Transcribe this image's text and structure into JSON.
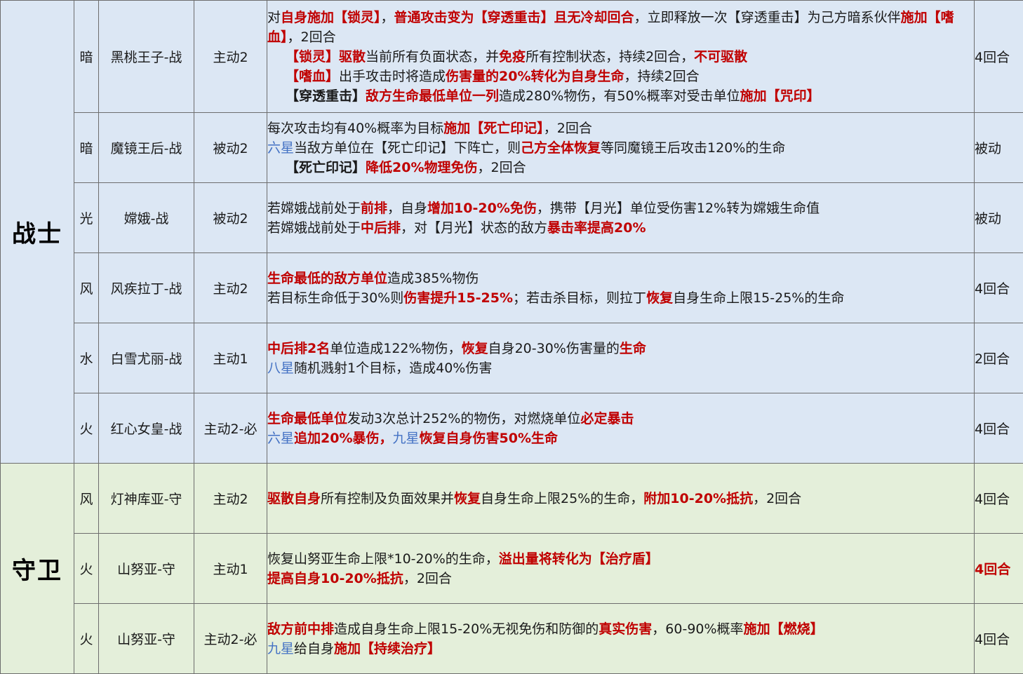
{
  "categories": {
    "warrior": "战士",
    "guard": "守卫"
  },
  "rows": [
    {
      "element": "暗",
      "name": "黑桃王子-战",
      "type": "主动2",
      "cd": "4回合",
      "lines": [
        [
          "对",
          "自身施加【锁灵】",
          "，",
          "普通攻击变为【穿透重击】且无冷却回合",
          "，立即释放一次【穿透重击】为己方暗系伙伴",
          "施加【嗜血】",
          "，2回合"
        ],
        [
          "【锁灵】",
          "驱散",
          "当前所有负面状态，并",
          "免疫",
          "所有控制状态，持续2回合，",
          "不可驱散"
        ],
        [
          "【嗜血】",
          "出手攻击时将造成",
          "伤害量的20%转化为自身生命",
          "，持续2回合"
        ],
        [
          "【穿透重击】",
          "敌方生命最低单位一列",
          "造成280%物伤，有50%概率对受击单位",
          "施加【咒印】"
        ]
      ]
    },
    {
      "element": "暗",
      "name": "魔镜王后-战",
      "type": "被动2",
      "cd": "被动",
      "lines": [
        [
          "每次攻击均有40%概率为目标",
          "施加【死亡印记】",
          "，2回合"
        ],
        [
          "六星",
          "当敌方单位在【死亡印记】下阵亡，则",
          "己方全体恢复",
          "等同魔镜王后攻击120%的生命"
        ],
        [
          "【死亡印记】",
          "降低20%物理免伤",
          "，2回合"
        ]
      ]
    },
    {
      "element": "光",
      "name": "嫦娥-战",
      "type": "被动2",
      "cd": "被动",
      "lines": [
        [
          "若嫦娥战前处于",
          "前排",
          "，自身",
          "增加10-20%免伤",
          "，携带【月光】单位受伤害12%转为嫦娥生命值"
        ],
        [
          "若嫦娥战前处于",
          "中后排",
          "，对【月光】状态的敌方",
          "暴击率提高20%"
        ]
      ]
    },
    {
      "element": "风",
      "name": "风疾拉丁-战",
      "type": "主动2",
      "cd": "4回合",
      "lines": [
        [
          "生命最低的敌方单位",
          "造成385%物伤"
        ],
        [
          "若目标生命低于30%则",
          "伤害提升15-25%",
          "；若击杀目标，则拉丁",
          "恢复",
          "自身生命上限15-25%的生命"
        ]
      ]
    },
    {
      "element": "水",
      "name": "白雪尤丽-战",
      "type": "主动1",
      "cd": "2回合",
      "lines": [
        [
          "中后排2名",
          "单位造成122%物伤，",
          "恢复",
          "自身20-30%伤害量的",
          "生命"
        ],
        [
          "八星",
          "随机溅射1个目标，造成40%伤害"
        ]
      ]
    },
    {
      "element": "火",
      "name": "红心女皇-战",
      "type": "主动2-必",
      "cd": "4回合",
      "lines": [
        [
          "生命最低单位",
          "发动3次总计252%的物伤，对燃烧单位",
          "必定暴击"
        ],
        [
          "六星",
          "追加20%暴伤，",
          "九星",
          "恢复自身伤害50%生命"
        ]
      ]
    },
    {
      "element": "风",
      "name": "灯神库亚-守",
      "type": "主动2",
      "cd": "4回合",
      "lines": [
        [
          "驱散自身",
          "所有控制及负面效果并",
          "恢复",
          "自身生命上限25%的生命，",
          "附加10-20%抵抗",
          "，2回合"
        ]
      ]
    },
    {
      "element": "火",
      "name": "山努亚-守",
      "type": "主动1",
      "cd": "4回合",
      "lines": [
        [
          "恢复山努亚生命上限*10-20%的生命，",
          "溢出量将转化为【治疗盾】"
        ],
        [
          "提高自身10-20%抵抗",
          "，2回合"
        ]
      ]
    },
    {
      "element": "火",
      "name": "山努亚-守",
      "type": "主动2-必",
      "cd": "4回合",
      "lines": [
        [
          "敌方前中排",
          "造成自身生命上限15-20%无视免伤和防御的",
          "真实伤害",
          "，60-90%概率",
          "施加【燃烧】"
        ],
        [
          "九星",
          "给自身",
          "施加【持续治疗】"
        ]
      ]
    }
  ],
  "colors": {
    "red": "#c00000",
    "blue": "#4472c4",
    "warrior_bg": "#dce7f4",
    "guard_bg": "#e4efda",
    "border": "#6d6d6d"
  }
}
